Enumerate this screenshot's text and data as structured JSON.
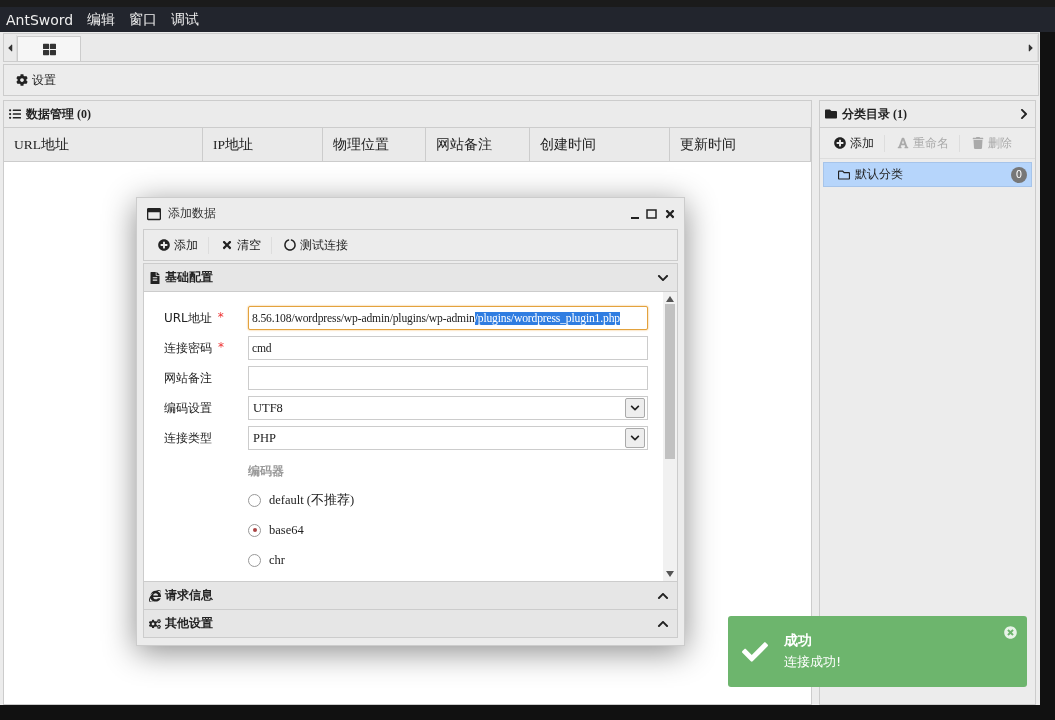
{
  "menubar": [
    "AntSword",
    "编辑",
    "窗口",
    "调试"
  ],
  "tabs": [
    {
      "kind": "grid",
      "selected": true
    }
  ],
  "toolbar": [
    {
      "label": "设置"
    }
  ],
  "data_panel": {
    "title": "数据管理 (0)",
    "columns": [
      "URL地址",
      "IP地址",
      "物理位置",
      "网站备注",
      "创建时间",
      "更新时间"
    ]
  },
  "category_panel": {
    "title": "分类目录 (1)",
    "actions": [
      {
        "kind": "add",
        "label": "添加",
        "disabled": false
      },
      {
        "kind": "rename",
        "label": "重命名",
        "disabled": true
      },
      {
        "kind": "delete",
        "label": "删除",
        "disabled": true
      }
    ],
    "items": [
      {
        "label": "默认分类",
        "count": "0",
        "selected": true
      }
    ]
  },
  "dialog": {
    "title": "添加数据",
    "actions": [
      {
        "kind": "add",
        "label": "添加"
      },
      {
        "kind": "clear",
        "label": "清空"
      },
      {
        "kind": "test",
        "label": "测试连接"
      }
    ],
    "sections": [
      {
        "kind": "basic",
        "title": "基础配置",
        "expanded": true
      },
      {
        "kind": "request",
        "title": "请求信息",
        "expanded": false
      },
      {
        "kind": "other",
        "title": "其他设置",
        "expanded": false
      }
    ],
    "fields": [
      {
        "kind": "text",
        "label": "URL地址",
        "required_mark": "*",
        "focused": true,
        "value": "8.56.108/wordpress/wp-admin/plugins/wp-admin",
        "selected_text": "/plugins/wordpress_plugin1.php"
      },
      {
        "kind": "text",
        "label": "连接密码",
        "required_mark": "*",
        "focused": false,
        "value": "cmd"
      },
      {
        "kind": "text",
        "label": "网站备注",
        "focused": false
      },
      {
        "kind": "select",
        "label": "编码设置",
        "value": "UTF8"
      },
      {
        "kind": "select",
        "label": "连接类型",
        "value": "PHP"
      }
    ],
    "encoder": {
      "label": "编码器",
      "options": [
        {
          "label": "default (不推荐)",
          "selected": false
        },
        {
          "label": "base64",
          "selected": true
        },
        {
          "label": "chr",
          "selected": false
        }
      ]
    }
  },
  "toast": {
    "title": "成功",
    "message": "连接成功!"
  }
}
